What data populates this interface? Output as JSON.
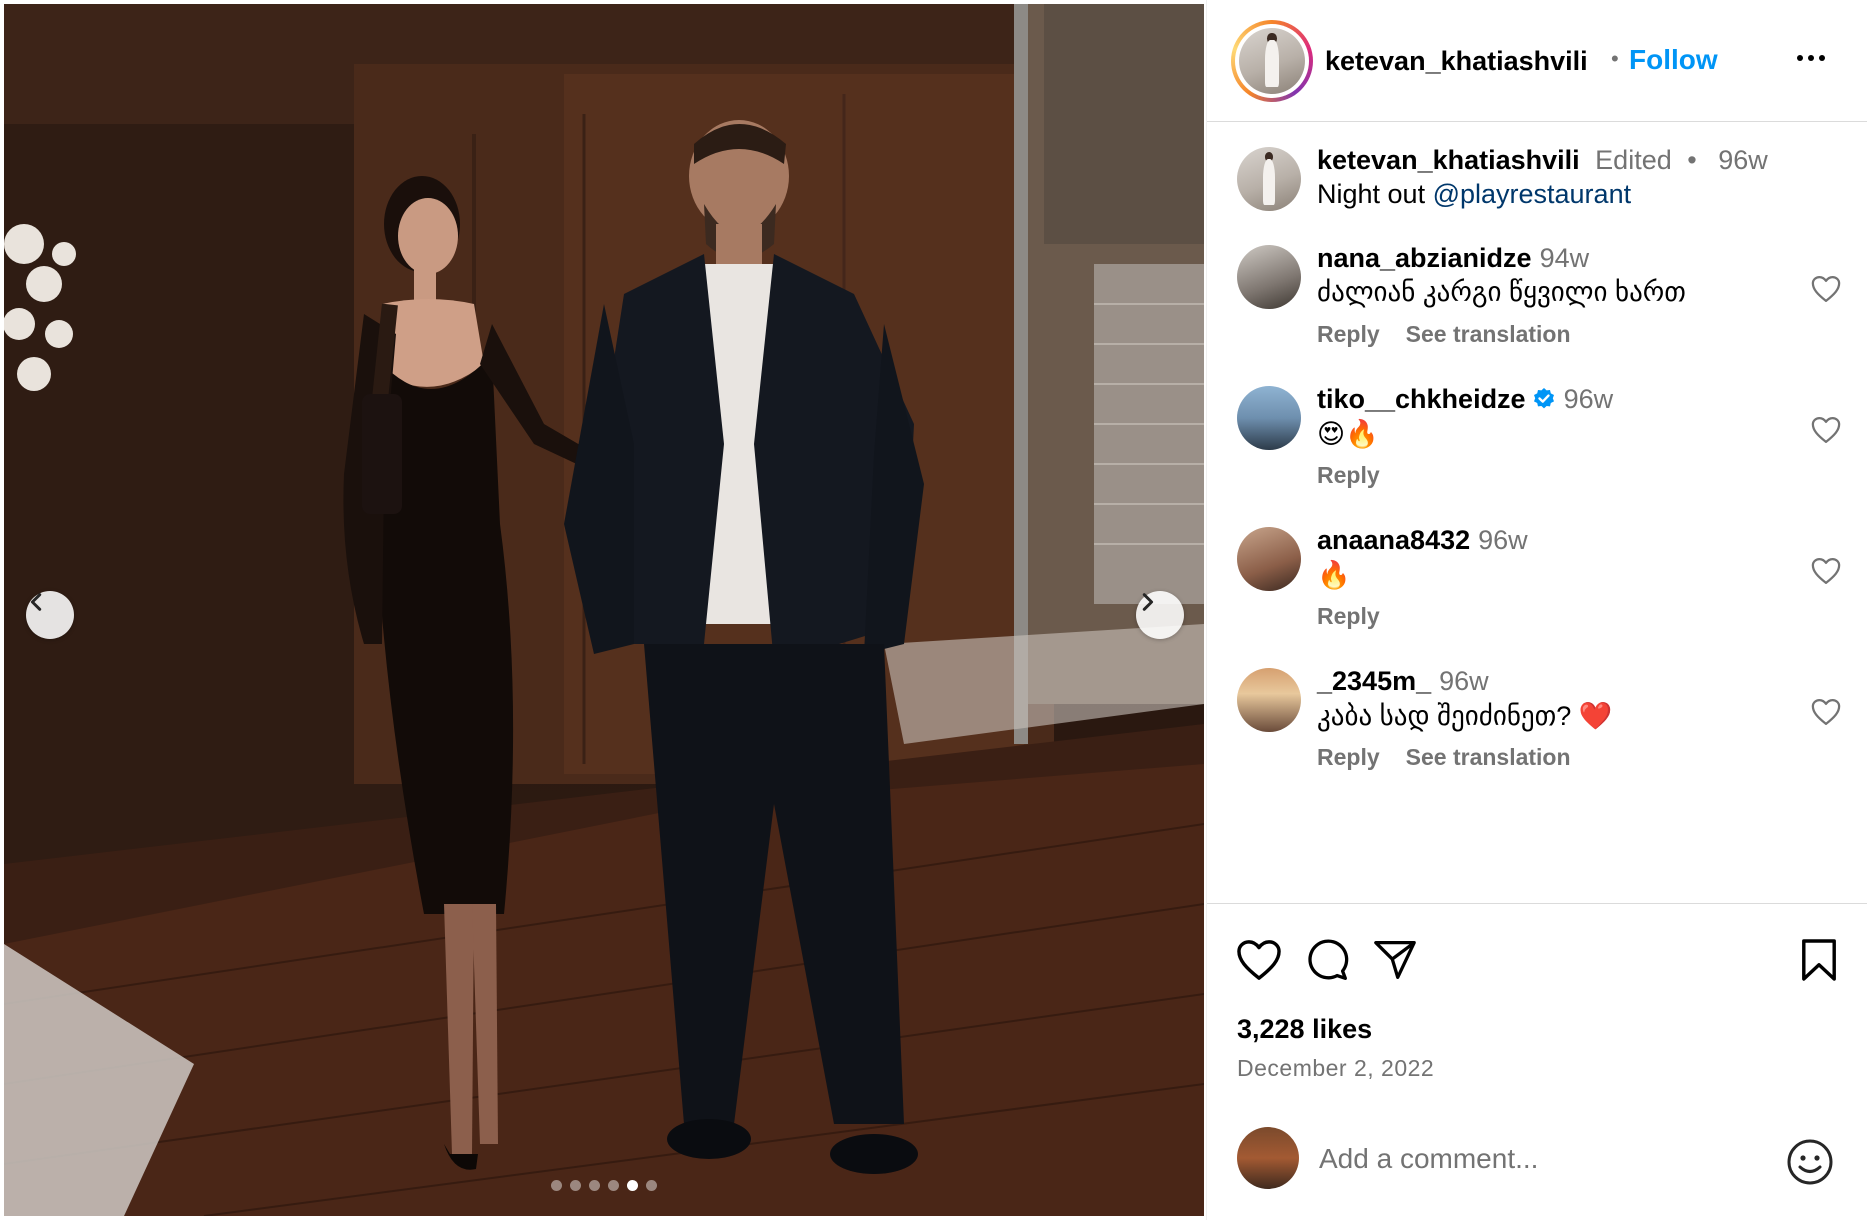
{
  "post": {
    "author": "ketevan_khatiashvili",
    "follow_label": "Follow",
    "separator": "•",
    "caption": {
      "username": "ketevan_khatiashvili",
      "edited": "Edited",
      "dot": "•",
      "time": "96w",
      "text": "Night out ",
      "mention": "@playrestaurant"
    },
    "carousel": {
      "slide_count": 6,
      "active_index": 4
    }
  },
  "comments": [
    {
      "username": "nana_abzianidze",
      "time": "94w",
      "text": "ძალიან კარგი წყვილი ხართ",
      "actions": [
        "Reply",
        "See translation"
      ],
      "verified": false
    },
    {
      "username": "tiko__chkheidze",
      "time": "96w",
      "text": "😍🔥",
      "actions": [
        "Reply"
      ],
      "verified": true
    },
    {
      "username": "anaana8432",
      "time": "96w",
      "text": "🔥",
      "actions": [
        "Reply"
      ],
      "verified": false
    },
    {
      "username": "_2345m_",
      "time": "96w",
      "text": "კაბა სად შეიძინეთ? ❤️",
      "actions": [
        "Reply",
        "See translation"
      ],
      "verified": false
    }
  ],
  "stats": {
    "likes": "3,228 likes",
    "date": "December 2, 2022"
  },
  "add_comment": {
    "placeholder": "Add a comment..."
  },
  "colors": {
    "link_blue": "#0095f6",
    "mention_blue": "#00376b",
    "muted_gray": "#737373",
    "verified_blue": "#0095f6"
  },
  "icons": [
    "chevron-left-icon",
    "chevron-right-icon",
    "more-icon",
    "heart-icon",
    "comment-icon",
    "share-icon",
    "bookmark-icon",
    "emoji-icon",
    "verified-icon"
  ]
}
